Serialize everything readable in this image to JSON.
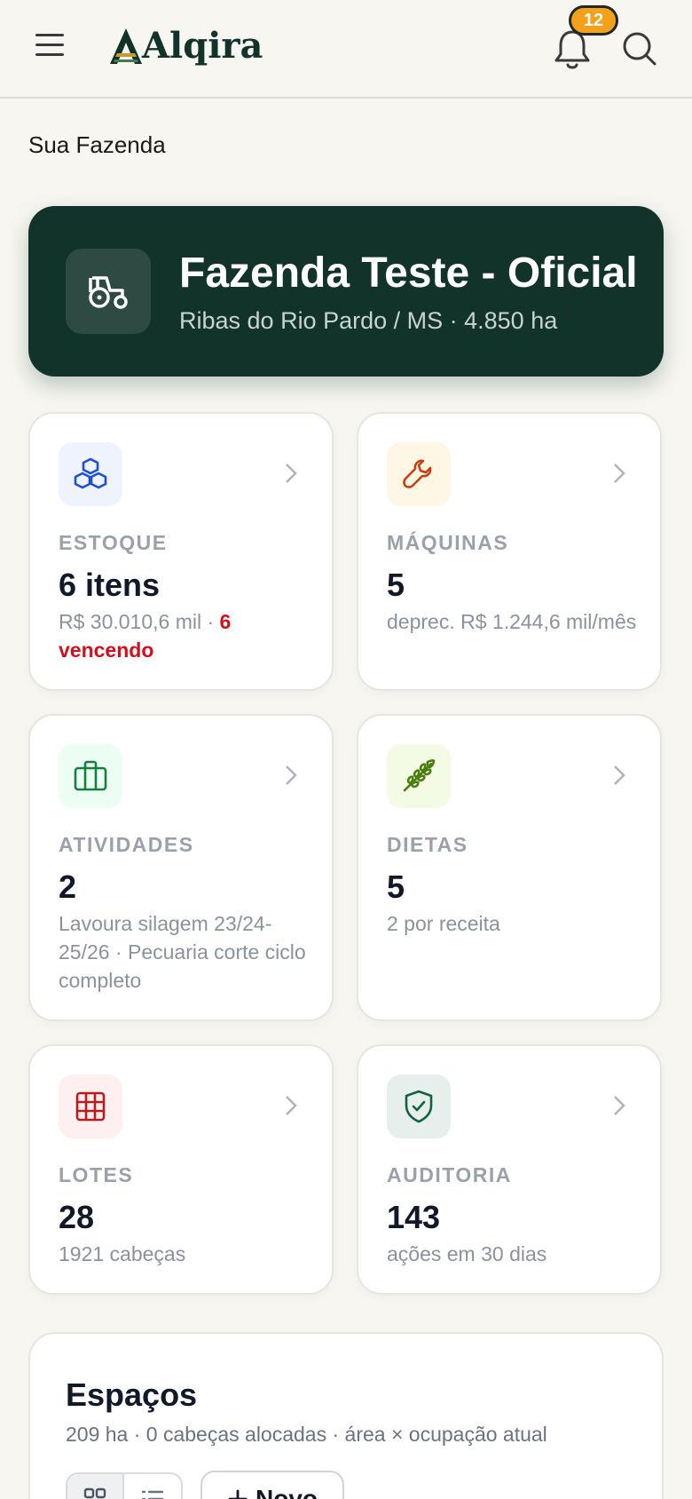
{
  "header": {
    "app_name": "Alqira",
    "notification_count": "12"
  },
  "section_label": "Sua Fazenda",
  "farm": {
    "name": "Fazenda Teste - Oficial",
    "subtitle": "Ribas do Rio Pardo / MS · 4.850 ha"
  },
  "tiles": {
    "estoque": {
      "label": "ESTOQUE",
      "value": "6 itens",
      "desc": "R$ 30.010,6 mil · ",
      "desc_warn": "6 vencendo"
    },
    "maquinas": {
      "label": "MÁQUINAS",
      "value": "5",
      "desc": "deprec. R$ 1.244,6 mil/mês"
    },
    "atividades": {
      "label": "ATIVIDADES",
      "value": "2",
      "desc": "Lavoura silagem 23/24-25/26 · Pecuaria corte ciclo completo"
    },
    "dietas": {
      "label": "DIETAS",
      "value": "5",
      "desc": "2 por receita"
    },
    "lotes": {
      "label": "LOTES",
      "value": "28",
      "desc": "1921 cabeças"
    },
    "auditoria": {
      "label": "AUDITORIA",
      "value": "143",
      "desc": "ações em 30 dias"
    }
  },
  "spaces": {
    "title": "Espaços",
    "subtitle": "209 ha · 0 cabeças alocadas · área × ocupação atual",
    "new_label": "Novo"
  },
  "icons": {
    "menu": "menu-icon",
    "bell": "bell-icon",
    "search": "search-icon",
    "tractor": "tractor-icon",
    "estoque": "boxes-icon",
    "maquinas": "wrench-icon",
    "atividades": "briefcase-icon",
    "dietas": "wheat-icon",
    "lotes": "grid-icon",
    "auditoria": "shield-check-icon"
  },
  "colors": {
    "brand_dark": "#11332a",
    "badge": "#f5a01a",
    "warn": "#d0101f",
    "estoque": "#1d4ed8",
    "maquinas": "#c2410c",
    "atividades": "#15803d",
    "dietas": "#4d7c0f",
    "lotes": "#b91c1c",
    "auditoria": "#11633f"
  }
}
